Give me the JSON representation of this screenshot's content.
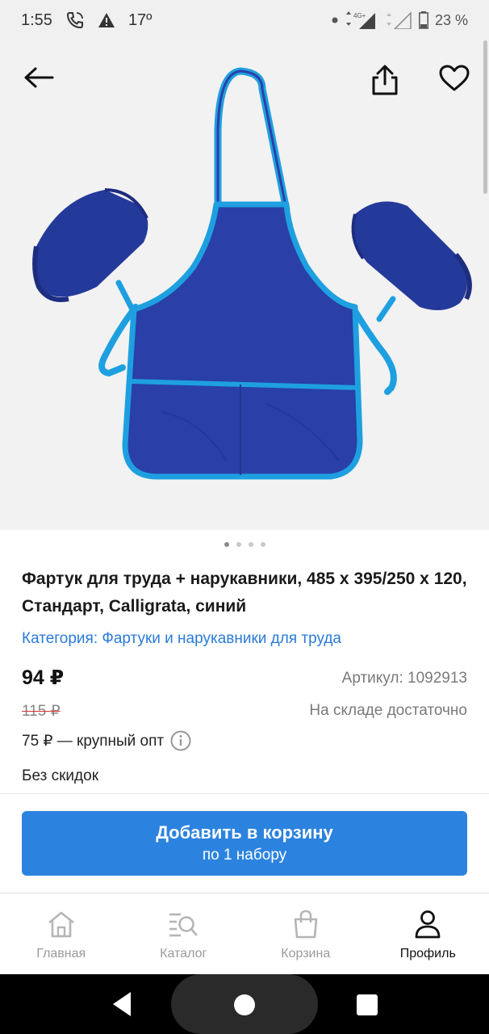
{
  "status": {
    "time": "1:55",
    "temperature": "17º",
    "network": "4G+",
    "battery": "23 %"
  },
  "header": {
    "back_icon": "arrow-left-icon",
    "share_icon": "share-icon",
    "favorite_icon": "heart-outline-icon"
  },
  "gallery": {
    "pages": 4,
    "active": 0
  },
  "product": {
    "title": "Фартук для труда + нарукавники, 485 х 395/250 х 120, Стандарт, Calligrata, синий",
    "category": "Категория: Фартуки и нарукавники для труда",
    "price": "94 ₽",
    "article": "Артикул: 1092913",
    "old_price": "115 ₽",
    "stock": "На складе достаточно",
    "wholesale": "75 ₽ — крупный опт",
    "no_discount": "Без скидок"
  },
  "cart_button": {
    "label": "Добавить в корзину",
    "sublabel": "по 1 набору"
  },
  "bottom_nav": [
    {
      "label": "Главная",
      "icon": "home-icon",
      "active": false
    },
    {
      "label": "Каталог",
      "icon": "catalog-search-icon",
      "active": false
    },
    {
      "label": "Корзина",
      "icon": "bag-icon",
      "active": false
    },
    {
      "label": "Профиль",
      "icon": "profile-icon",
      "active": true
    }
  ],
  "colors": {
    "accent": "#2c83df",
    "link": "#2a7bd8",
    "apron": "#2a3fa8",
    "apron_trim": "#1ea0e0"
  }
}
